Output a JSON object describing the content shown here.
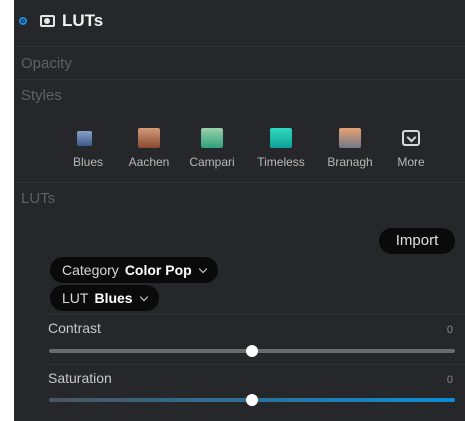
{
  "header": {
    "title": "LUTs",
    "enabled": true
  },
  "sections": {
    "opacity": "Opacity",
    "styles": "Styles",
    "luts": "LUTs"
  },
  "styles": [
    {
      "label": "Blues",
      "color_top": "#8aa0c8",
      "color_bottom": "#3b5a8a"
    },
    {
      "label": "Aachen",
      "color_top": "#d29a78",
      "color_bottom": "#8a4a30"
    },
    {
      "label": "Campari",
      "color_top": "#9ad0a8",
      "color_bottom": "#2fa07a"
    },
    {
      "label": "Timeless",
      "color_top": "#2fd8c0",
      "color_bottom": "#10a098"
    },
    {
      "label": "Branagh",
      "color_top": "#e8a070",
      "color_bottom": "#70788a"
    },
    {
      "label": "More",
      "icon": "chevron-down-box-icon"
    }
  ],
  "import_label": "Import",
  "category": {
    "label": "Category",
    "value": "Color Pop"
  },
  "lut": {
    "label": "LUT",
    "value": "Blues"
  },
  "sliders": [
    {
      "label": "Contrast",
      "value": "0",
      "position": 0.5,
      "track_color": "#6b6b6e"
    },
    {
      "label": "Saturation",
      "value": "0",
      "position": 0.5,
      "track_gradient": [
        "#4a5560",
        "#0a8fd6"
      ]
    }
  ],
  "colors": {
    "panel": "#26272a",
    "accent": "#1a8fe8"
  }
}
